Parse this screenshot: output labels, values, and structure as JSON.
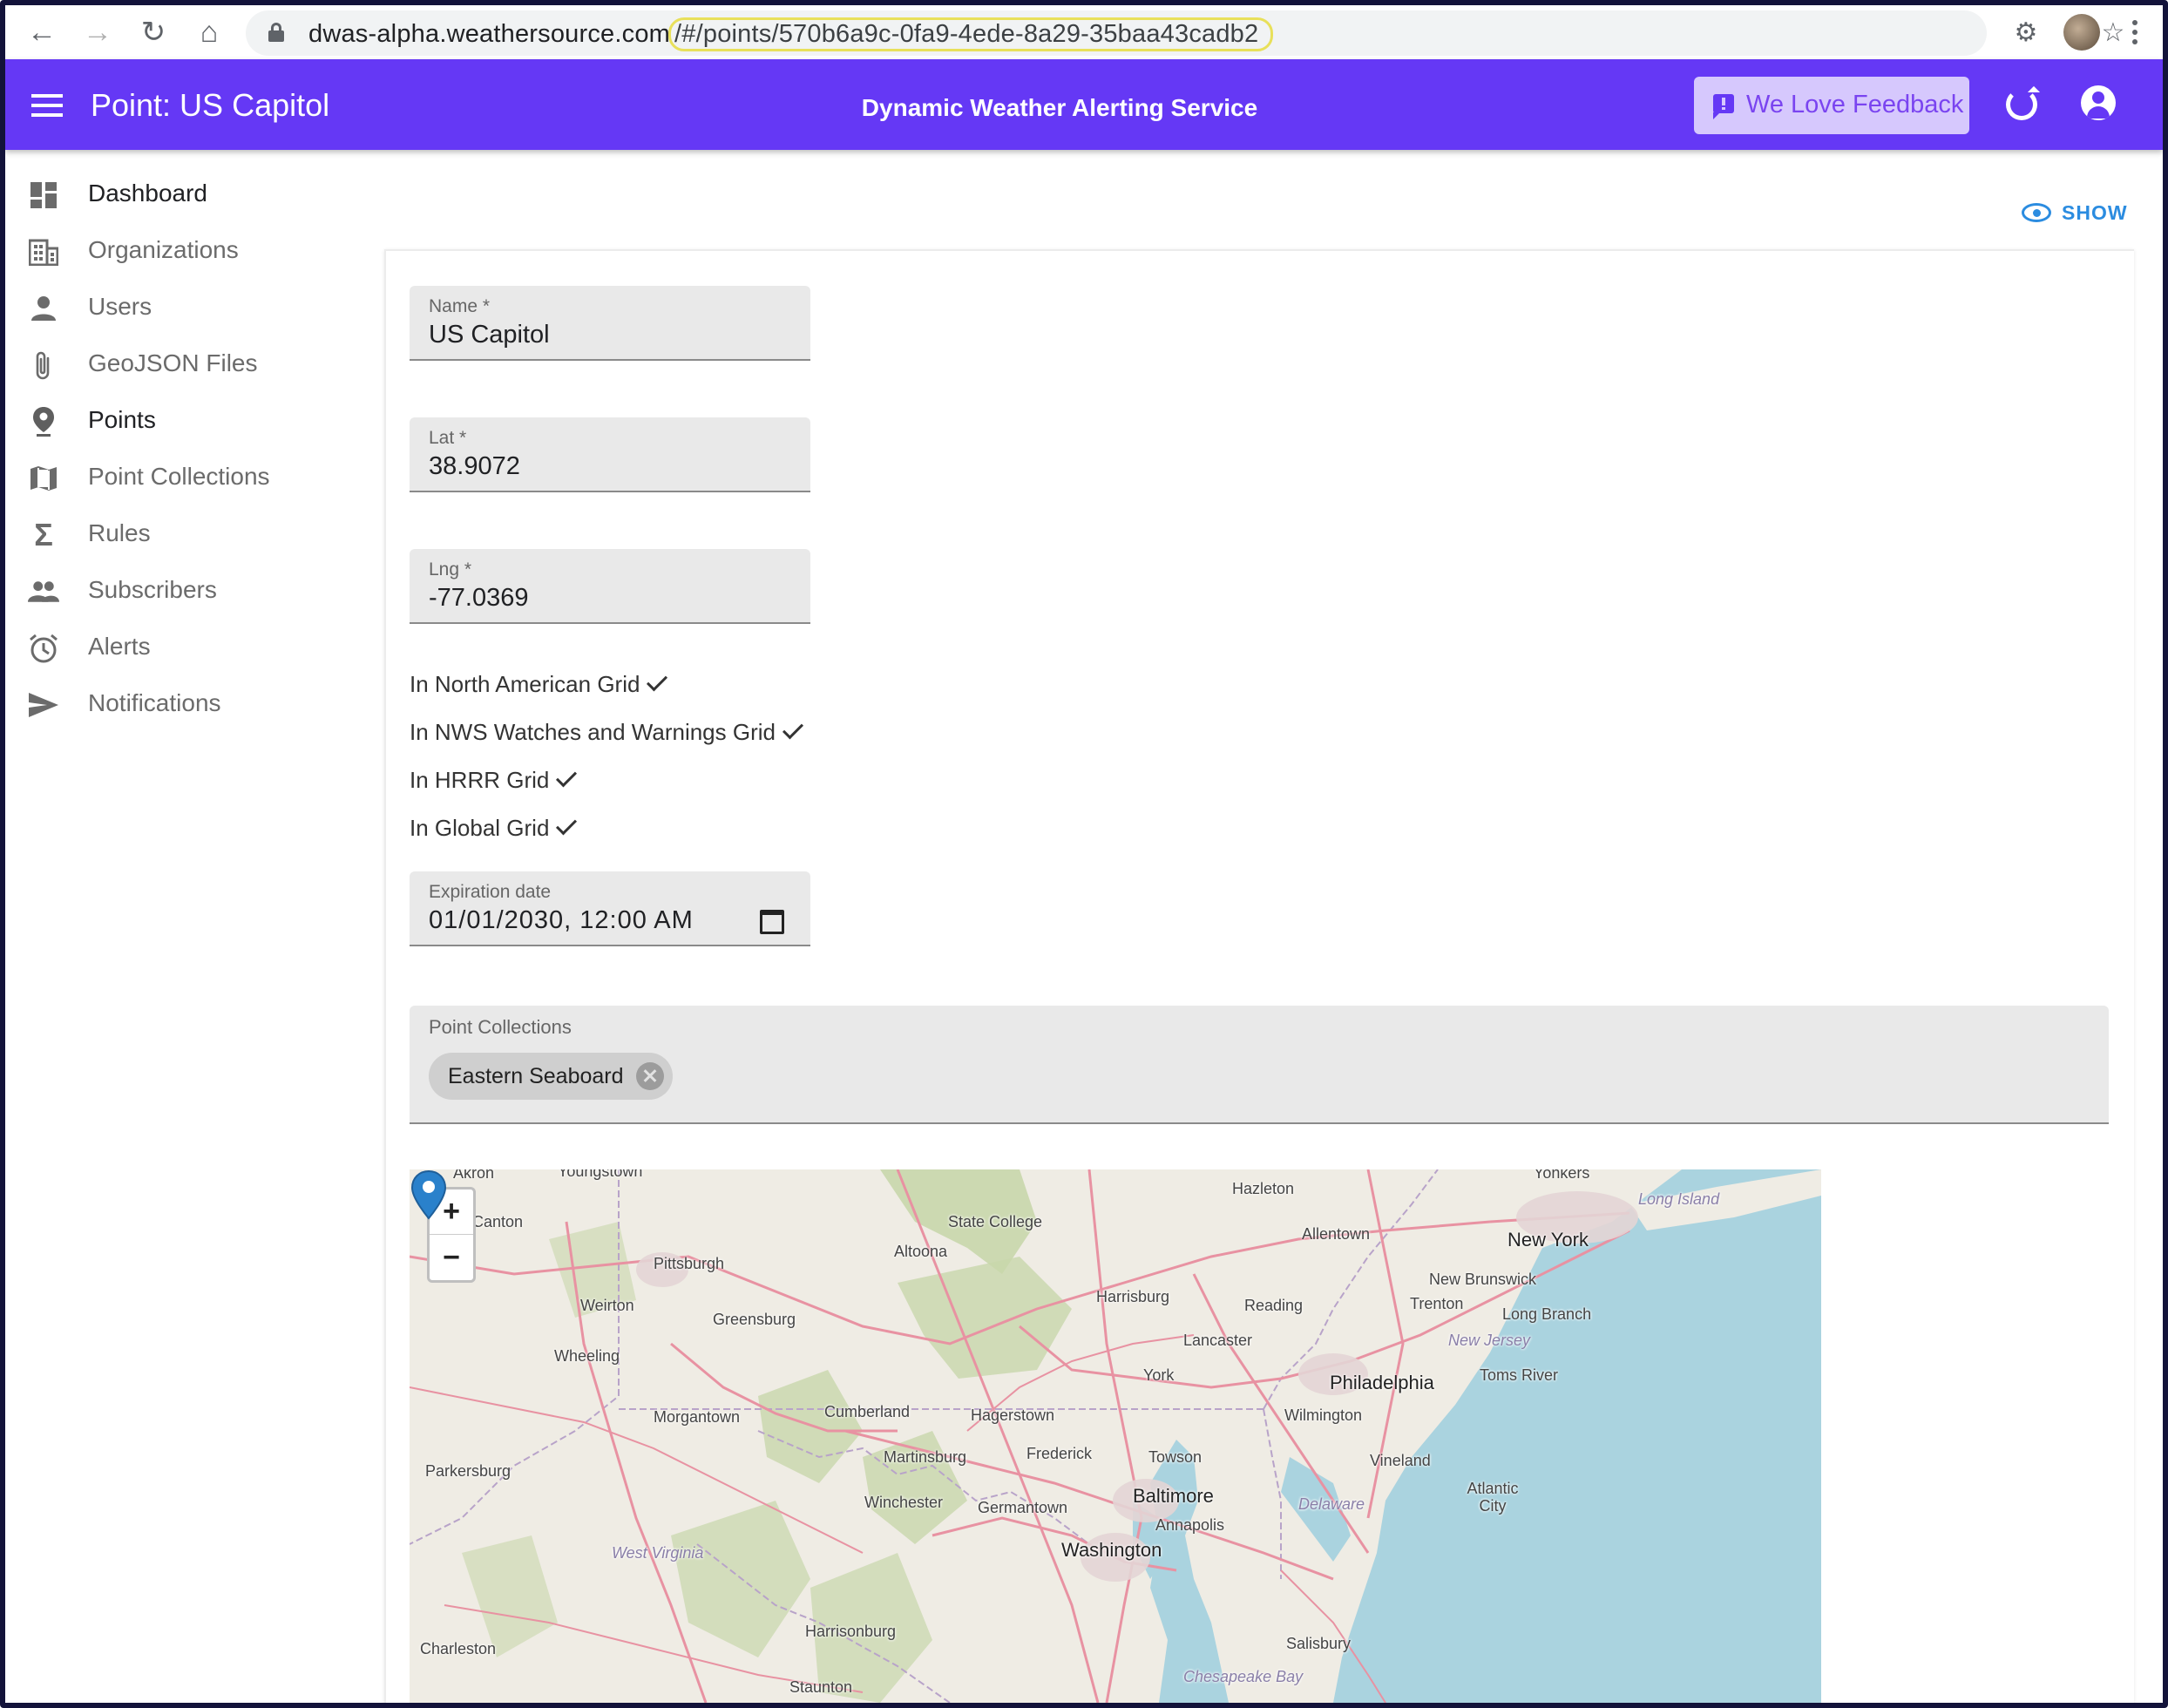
{
  "browser": {
    "url_host": "dwas-alpha.weathersource.com",
    "url_fragment": "/#/points/570b6a9c-0fa9-4ede-8a29-35baa43cadb2"
  },
  "appbar": {
    "title": "Point: US Capitol",
    "service_name": "Dynamic Weather Alerting Service",
    "feedback_label": "We Love Feedback"
  },
  "sidebar": {
    "items": [
      {
        "label": "Dashboard",
        "icon": "dashboard-icon"
      },
      {
        "label": "Organizations",
        "icon": "building-icon"
      },
      {
        "label": "Users",
        "icon": "person-icon"
      },
      {
        "label": "GeoJSON Files",
        "icon": "paperclip-icon"
      },
      {
        "label": "Points",
        "icon": "map-pin-icon"
      },
      {
        "label": "Point Collections",
        "icon": "map-icon"
      },
      {
        "label": "Rules",
        "icon": "sigma-icon"
      },
      {
        "label": "Subscribers",
        "icon": "people-icon"
      },
      {
        "label": "Alerts",
        "icon": "alarm-icon"
      },
      {
        "label": "Notifications",
        "icon": "send-icon"
      }
    ],
    "active_item": "Points"
  },
  "toolbar": {
    "show_label": "SHOW"
  },
  "form": {
    "name": {
      "label": "Name *",
      "value": "US Capitol"
    },
    "lat": {
      "label": "Lat *",
      "value": "38.9072"
    },
    "lng": {
      "label": "Lng *",
      "value": "-77.0369"
    },
    "grids": [
      {
        "label": "In North American Grid",
        "checked": true
      },
      {
        "label": "In NWS Watches and Warnings Grid",
        "checked": true
      },
      {
        "label": "In HRRR Grid",
        "checked": true
      },
      {
        "label": "In Global Grid",
        "checked": true
      }
    ],
    "expiration": {
      "label": "Expiration date",
      "value": "01/01/2030, 12:00 AM"
    },
    "point_collections": {
      "label": "Point Collections",
      "chips": [
        "Eastern Seaboard"
      ]
    }
  },
  "map": {
    "zoom_in": "+",
    "zoom_out": "−",
    "labels": [
      "Akron",
      "Youngstown",
      "Canton",
      "Pittsburgh",
      "Weirton",
      "Greensburg",
      "Wheeling",
      "Morgantown",
      "Parkersburg",
      "West Virginia",
      "Charleston",
      "Cumberland",
      "Altoona",
      "State College",
      "Hazleton",
      "Allentown",
      "Harrisburg",
      "Reading",
      "Lancaster",
      "York",
      "Hagerstown",
      "Martinsburg",
      "Frederick",
      "Winchester",
      "Germantown",
      "Towson",
      "Baltimore",
      "Annapolis",
      "Washington",
      "Harrisonburg",
      "Staunton",
      "Philadelphia",
      "Wilmington",
      "Vineland",
      "Delaware",
      "Salisbury",
      "Chesapeake Bay",
      "New York",
      "Yonkers",
      "Long Island",
      "New Brunswick",
      "Trenton",
      "Long Branch",
      "New Jersey",
      "Toms River",
      "Atlantic City"
    ],
    "marker_label": "Washington"
  }
}
